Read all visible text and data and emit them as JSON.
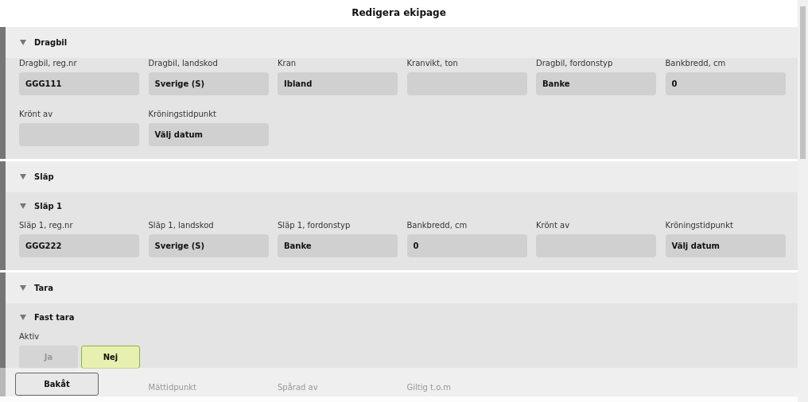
{
  "window": {
    "title": "Redigera ekipage"
  },
  "sections": [
    {
      "title": "Dragbil",
      "expanded": true,
      "fields": [
        {
          "label": "Dragbil, reg.nr",
          "value": "GGG111"
        },
        {
          "label": "Dragbil, landskod",
          "value": "Sverige (S)"
        },
        {
          "label": "Kran",
          "value": "Ibland"
        },
        {
          "label": "Kranvikt, ton"
        },
        {
          "label": "Dragbil, fordonstyp",
          "value": "Banke"
        },
        {
          "label": "Bankbredd, cm",
          "value": "0"
        },
        {
          "label": "Krönt av"
        },
        {
          "label": "Kröningstidpunkt",
          "value": "Välj datum"
        }
      ]
    },
    {
      "title": "Släp",
      "expanded": true,
      "groups": [
        {
          "title": "Släp 1",
          "expanded": true,
          "fields": [
            {
              "label": "Släp 1, reg.nr",
              "value": "GGG222"
            },
            {
              "label": "Släp 1, landskod",
              "value": "Sverige (S)"
            },
            {
              "label": "Släp 1, fordonstyp",
              "value": "Banke"
            },
            {
              "label": "Bankbredd, cm",
              "value": "0"
            },
            {
              "label": "Krönt av"
            },
            {
              "label": "Kröningstidpunkt",
              "value": "Välj datum"
            }
          ]
        }
      ]
    },
    {
      "title": "Tara",
      "expanded": true,
      "groups": [
        {
          "title": "Fast tara",
          "expanded": true,
          "toggle": {
            "label": "Aktiv",
            "options": [
              {
                "label": "Ja",
                "selected": false
              },
              {
                "label": "Nej",
                "selected": true
              }
            ]
          },
          "hidden_labels": [
            "Mättidpunkt",
            "Spårad av",
            "Giltig t.o.m"
          ]
        }
      ]
    }
  ],
  "footer": {
    "back_button": "Bakåt"
  }
}
